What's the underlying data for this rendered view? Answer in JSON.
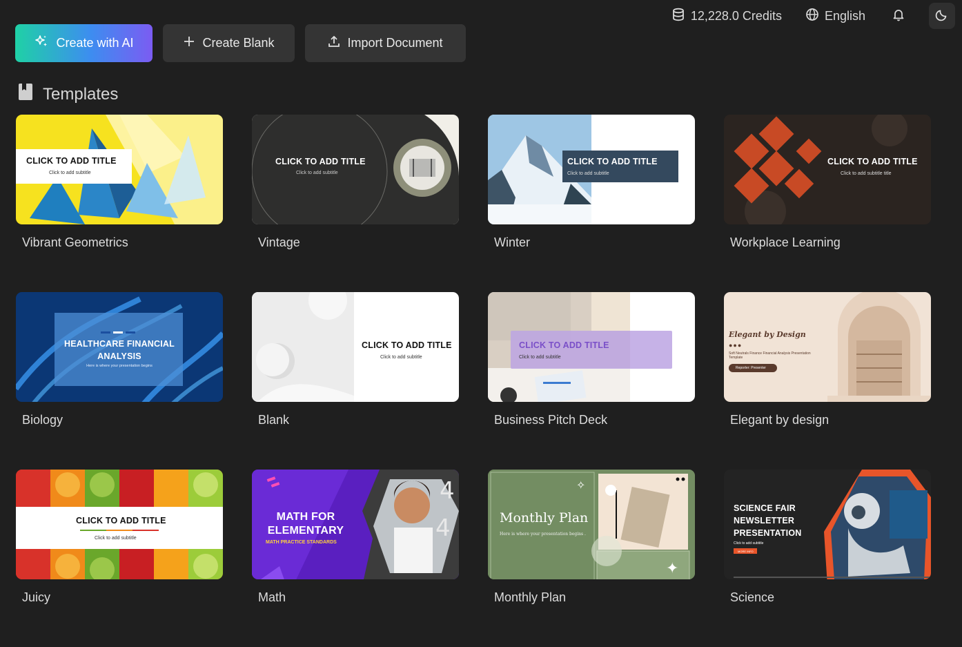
{
  "topbar": {
    "credits": "12,228.0 Credits",
    "language": "English",
    "credits_icon": "database-icon",
    "language_icon": "globe-icon",
    "notification_icon": "bell-icon",
    "theme_icon": "moon-icon"
  },
  "actions": {
    "create_ai": "Create with AI",
    "create_blank": "Create Blank",
    "import_document": "Import Document"
  },
  "section": {
    "title": "Templates"
  },
  "templates": [
    {
      "name": "Vibrant Geometrics",
      "title": "CLICK TO ADD TITLE",
      "subtitle": "Click to add subtitle"
    },
    {
      "name": "Vintage",
      "title": "CLICK TO ADD TITLE",
      "subtitle": "Click to add subtitle"
    },
    {
      "name": "Winter",
      "title": "CLICK TO ADD TITLE",
      "subtitle": "Click to add subtitle"
    },
    {
      "name": "Workplace Learning",
      "title": "CLICK TO ADD TITLE",
      "subtitle": "Click to add subtitle title"
    },
    {
      "name": "Biology",
      "title": "HEALTHCARE FINANCIAL ANALYSIS",
      "subtitle": "Here is where your presentation begins"
    },
    {
      "name": "Blank",
      "title": "CLICK TO ADD TITLE",
      "subtitle": "Click to add subtitle"
    },
    {
      "name": "Business Pitch Deck",
      "title": "CLICK TO ADD TITLE",
      "subtitle": "Click to add subtitle"
    },
    {
      "name": "Elegant by design",
      "title": "Elegant by Design",
      "subtitle": "Soft Neutrals Finance Financial Analysis Presentation Template",
      "tag": "Reporter: Presenter"
    },
    {
      "name": "Juicy",
      "title": "CLICK TO ADD TITLE",
      "subtitle": "Click to add subtitle"
    },
    {
      "name": "Math",
      "title": "MATH FOR ELEMENTARY",
      "subtitle": "MATH PRACTICE STANDARDS"
    },
    {
      "name": "Monthly Plan",
      "title": "Monthly Plan",
      "subtitle": "Here is where your presentation begins ."
    },
    {
      "name": "Science",
      "title": "SCIENCE FAIR NEWSLETTER PRESENTATION",
      "subtitle": "Click to add subtitle",
      "tag": "MORE INFO"
    }
  ]
}
